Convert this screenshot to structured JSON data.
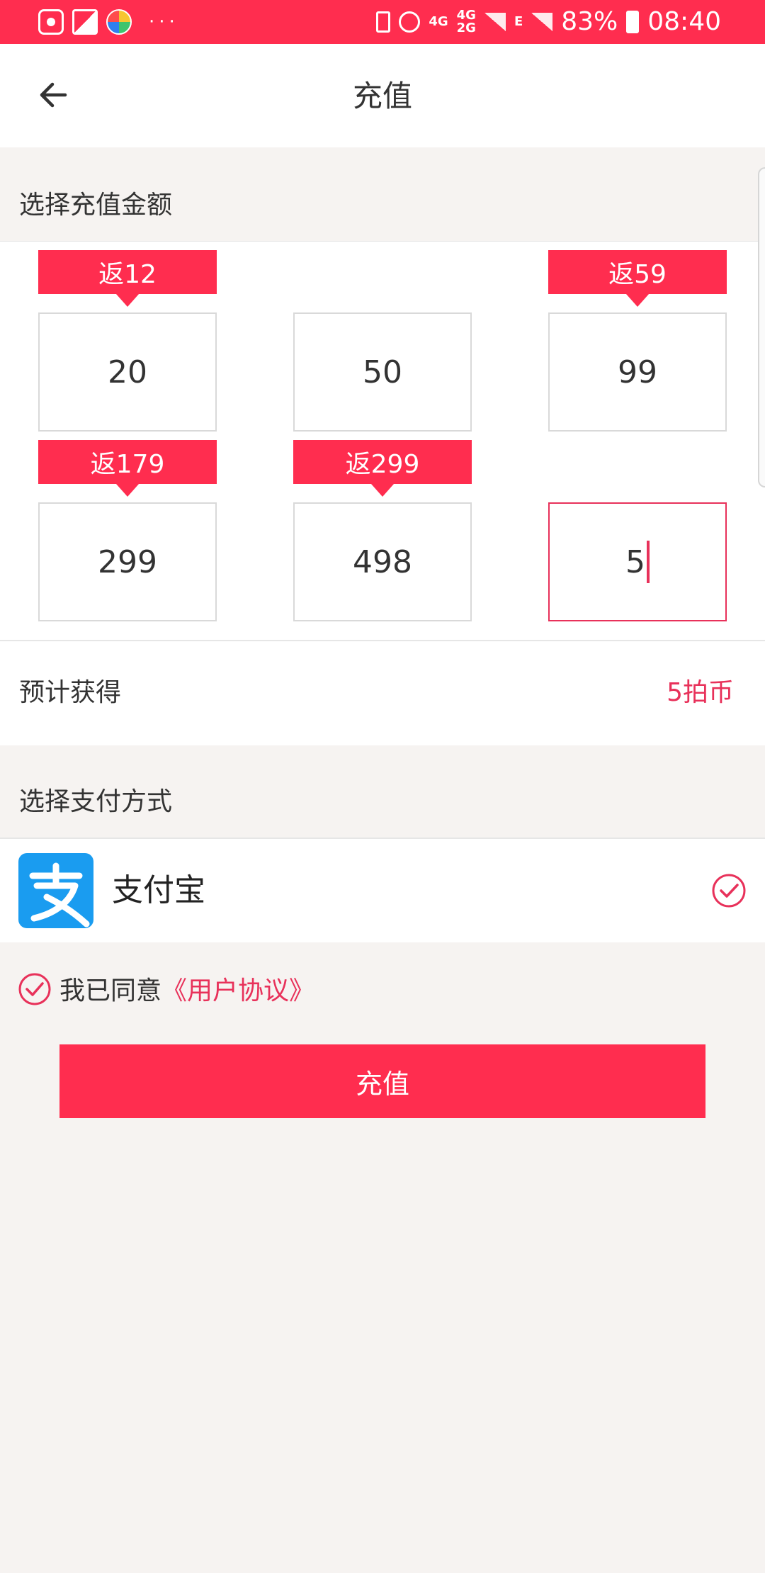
{
  "status_bar": {
    "battery_percent": "83%",
    "time": "08:40",
    "network_1": "4G",
    "network_2": "4G",
    "network_2b": "2G",
    "network_3": "E",
    "dots": "···",
    "icons": [
      "baidu-icon",
      "gallery-icon",
      "ball-icon",
      "battery-saver-icon",
      "alarm-icon",
      "signal-icon",
      "battery-icon"
    ]
  },
  "header": {
    "title": "充值"
  },
  "amount_section": {
    "label": "选择充值金额",
    "options": [
      {
        "amount": "20",
        "bonus": "返12"
      },
      {
        "amount": "50",
        "bonus": ""
      },
      {
        "amount": "99",
        "bonus": "返59"
      },
      {
        "amount": "299",
        "bonus": "返179"
      },
      {
        "amount": "498",
        "bonus": "返299"
      }
    ],
    "custom_value": "5"
  },
  "expected": {
    "label": "预计获得",
    "value": "5拍币"
  },
  "payment_section": {
    "label": "选择支付方式",
    "method": {
      "name": "支付宝",
      "selected": true
    }
  },
  "agreement": {
    "text": "我已同意",
    "link": "《用户协议》",
    "checked": true
  },
  "submit": {
    "label": "充值"
  },
  "colors": {
    "accent": "#ff2d4f",
    "accent_text": "#e8315a",
    "alipay": "#1a9cf0",
    "background": "#f6f3f1"
  }
}
